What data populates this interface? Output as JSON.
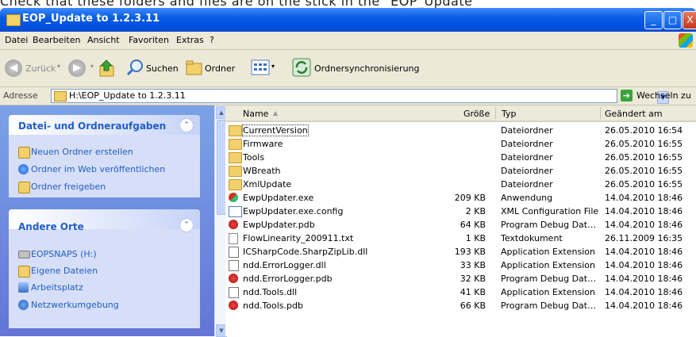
{
  "page_caption": "Check that these folders and files are on the stick in the \"EOP_Update",
  "window": {
    "title": "EOP_Update to 1.2.3.11",
    "min_glyph": "_",
    "max_glyph": "□",
    "close_glyph": "X"
  },
  "menu": [
    "Datei",
    "Bearbeiten",
    "Ansicht",
    "Favoriten",
    "Extras",
    "?"
  ],
  "toolbar": {
    "back": "Zurück",
    "back_glyph": "◀",
    "forward_glyph": "▶",
    "dropdown_glyph": "▾",
    "search": "Suchen",
    "folders": "Ordner",
    "sync": "Ordnersynchronisierung"
  },
  "address": {
    "label": "Adresse",
    "value": "H:\\EOP_Update to 1.2.3.11",
    "dropdown_glyph": "▼",
    "go_glyph": "➔",
    "go": "Wechseln zu"
  },
  "sidebar": {
    "collapse_glyph": "⌃",
    "tasks": {
      "title": "Datei- und Ordneraufgaben",
      "items": [
        "Neuen Ordner erstellen",
        "Ordner im Web veröffentlichen",
        "Ordner freigeben"
      ]
    },
    "places": {
      "title": "Andere Orte",
      "items": [
        "EOPSNAPS (H:)",
        "Eigene Dateien",
        "Arbeitsplatz",
        "Netzwerkumgebung"
      ]
    }
  },
  "scrollbar": {
    "up_glyph": "▲",
    "down_glyph": "▼"
  },
  "columns": {
    "name": "Name",
    "sort_glyph": "▲",
    "size": "Größe",
    "type": "Typ",
    "date": "Geändert am"
  },
  "files": [
    {
      "name": "CurrentVersion",
      "size": "",
      "type": "Dateiordner",
      "date": "26.05.2010 16:54",
      "icon": "folder"
    },
    {
      "name": "Firmware",
      "size": "",
      "type": "Dateiordner",
      "date": "26.05.2010 16:55",
      "icon": "folder"
    },
    {
      "name": "Tools",
      "size": "",
      "type": "Dateiordner",
      "date": "26.05.2010 16:55",
      "icon": "folder"
    },
    {
      "name": "WBreath",
      "size": "",
      "type": "Dateiordner",
      "date": "26.05.2010 16:55",
      "icon": "folder"
    },
    {
      "name": "XmlUpdate",
      "size": "",
      "type": "Dateiordner",
      "date": "26.05.2010 16:55",
      "icon": "folder"
    },
    {
      "name": "EwpUpdater.exe",
      "size": "209 KB",
      "type": "Anwendung",
      "date": "14.04.2010 18:46",
      "icon": "exe"
    },
    {
      "name": "EwpUpdater.exe.config",
      "size": "2 KB",
      "type": "XML Configuration File",
      "date": "14.04.2010 18:46",
      "icon": "config"
    },
    {
      "name": "EwpUpdater.pdb",
      "size": "64 KB",
      "type": "Program Debug Dat…",
      "date": "14.04.2010 18:46",
      "icon": "pdb"
    },
    {
      "name": "FlowLinearity_200911.txt",
      "size": "1 KB",
      "type": "Textdokument",
      "date": "26.11.2009 16:35",
      "icon": "txt"
    },
    {
      "name": "ICSharpCode.SharpZipLib.dll",
      "size": "193 KB",
      "type": "Application Extension",
      "date": "14.04.2010 18:46",
      "icon": "dll"
    },
    {
      "name": "ndd.ErrorLogger.dll",
      "size": "33 KB",
      "type": "Application Extension",
      "date": "14.04.2010 18:46",
      "icon": "dll"
    },
    {
      "name": "ndd.ErrorLogger.pdb",
      "size": "32 KB",
      "type": "Program Debug Dat…",
      "date": "14.04.2010 18:46",
      "icon": "pdb"
    },
    {
      "name": "ndd.Tools.dll",
      "size": "41 KB",
      "type": "Application Extension",
      "date": "14.04.2010 18:46",
      "icon": "dll"
    },
    {
      "name": "ndd.Tools.pdb",
      "size": "66 KB",
      "type": "Program Debug Dat…",
      "date": "14.04.2010 18:46",
      "icon": "pdb"
    }
  ]
}
